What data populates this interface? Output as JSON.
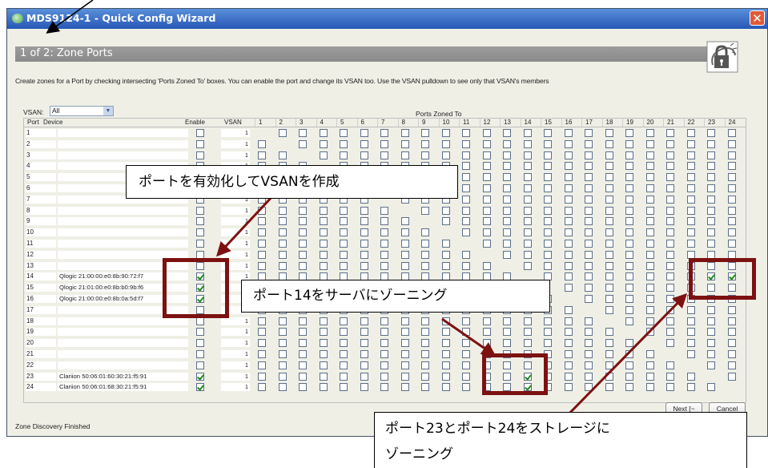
{
  "window": {
    "title": "MDS9124-1 - Quick Config Wizard",
    "close_symbol": "✕"
  },
  "step": {
    "title": "1 of 2: Zone Ports",
    "instructions": "Create zones for a Port by checking intersecting 'Ports Zoned To' boxes. You can enable the port and change its VSAN too. Use the VSAN pulldown to see only that VSAN's members"
  },
  "filter": {
    "vsan_label": "VSAN:",
    "vsan_value": "All",
    "ports_zoned_to_label": "Ports Zoned To"
  },
  "table": {
    "headers": {
      "port": "Port",
      "device": "Device",
      "enable": "Enable",
      "vsan": "VSAN"
    },
    "zone_columns": [
      "1",
      "2",
      "3",
      "4",
      "5",
      "6",
      "7",
      "8",
      "9",
      "10",
      "11",
      "12",
      "13",
      "14",
      "15",
      "16",
      "17",
      "18",
      "19",
      "20",
      "21",
      "22",
      "23",
      "24"
    ],
    "rows": [
      {
        "port": "1",
        "device": "",
        "enabled": false,
        "vsan": "1",
        "zoned_to": []
      },
      {
        "port": "2",
        "device": "",
        "enabled": false,
        "vsan": "1",
        "zoned_to": []
      },
      {
        "port": "3",
        "device": "",
        "enabled": false,
        "vsan": "1",
        "zoned_to": []
      },
      {
        "port": "4",
        "device": "",
        "enabled": false,
        "vsan": "1",
        "zoned_to": []
      },
      {
        "port": "5",
        "device": "",
        "enabled": false,
        "vsan": "1",
        "zoned_to": []
      },
      {
        "port": "6",
        "device": "",
        "enabled": false,
        "vsan": "1",
        "zoned_to": []
      },
      {
        "port": "7",
        "device": "",
        "enabled": false,
        "vsan": "1",
        "zoned_to": []
      },
      {
        "port": "8",
        "device": "",
        "enabled": false,
        "vsan": "1",
        "zoned_to": []
      },
      {
        "port": "9",
        "device": "",
        "enabled": false,
        "vsan": "1",
        "zoned_to": []
      },
      {
        "port": "10",
        "device": "",
        "enabled": false,
        "vsan": "1",
        "zoned_to": []
      },
      {
        "port": "11",
        "device": "",
        "enabled": false,
        "vsan": "1",
        "zoned_to": []
      },
      {
        "port": "12",
        "device": "",
        "enabled": false,
        "vsan": "1",
        "zoned_to": []
      },
      {
        "port": "13",
        "device": "",
        "enabled": false,
        "vsan": "1",
        "zoned_to": []
      },
      {
        "port": "14",
        "device": "Qlogic 21:00:00:e0:8b:90:72:f7",
        "enabled": true,
        "vsan": "1",
        "zoned_to": [
          23,
          24
        ]
      },
      {
        "port": "15",
        "device": "Qlogic 21:01:00:e0:8b:b0:9b:f6",
        "enabled": true,
        "vsan": "1",
        "zoned_to": []
      },
      {
        "port": "16",
        "device": "Qlogic 21:00:00:e0:8b:0a:5d:f7",
        "enabled": true,
        "vsan": "1",
        "zoned_to": []
      },
      {
        "port": "17",
        "device": "",
        "enabled": false,
        "vsan": "1",
        "zoned_to": []
      },
      {
        "port": "18",
        "device": "",
        "enabled": false,
        "vsan": "1",
        "zoned_to": []
      },
      {
        "port": "19",
        "device": "",
        "enabled": false,
        "vsan": "1",
        "zoned_to": []
      },
      {
        "port": "20",
        "device": "",
        "enabled": false,
        "vsan": "1",
        "zoned_to": []
      },
      {
        "port": "21",
        "device": "",
        "enabled": false,
        "vsan": "1",
        "zoned_to": []
      },
      {
        "port": "22",
        "device": "",
        "enabled": false,
        "vsan": "1",
        "zoned_to": []
      },
      {
        "port": "23",
        "device": "Clariion 50:06:01:60:30:21:f5:91",
        "enabled": true,
        "vsan": "1",
        "zoned_to": [
          14
        ]
      },
      {
        "port": "24",
        "device": "Clariion 50:06:01:68:30:21:f5:91",
        "enabled": true,
        "vsan": "1",
        "zoned_to": [
          14
        ]
      }
    ]
  },
  "buttons": {
    "next": "Next [~",
    "cancel": "Cancel"
  },
  "status_text": "Zone Discovery Finished",
  "annotations": {
    "enable_vsan": "ポートを有効化してVSANを作成",
    "zone_port14": "ポート14をサーバにゾーニング",
    "zone_storage_line1": "ポート23とポート24をストレージに",
    "zone_storage_line2": "ゾーニング"
  },
  "colors": {
    "titlebar": "#2657b8",
    "highlight_border": "#7d1111",
    "check": "#1d8a1d"
  }
}
